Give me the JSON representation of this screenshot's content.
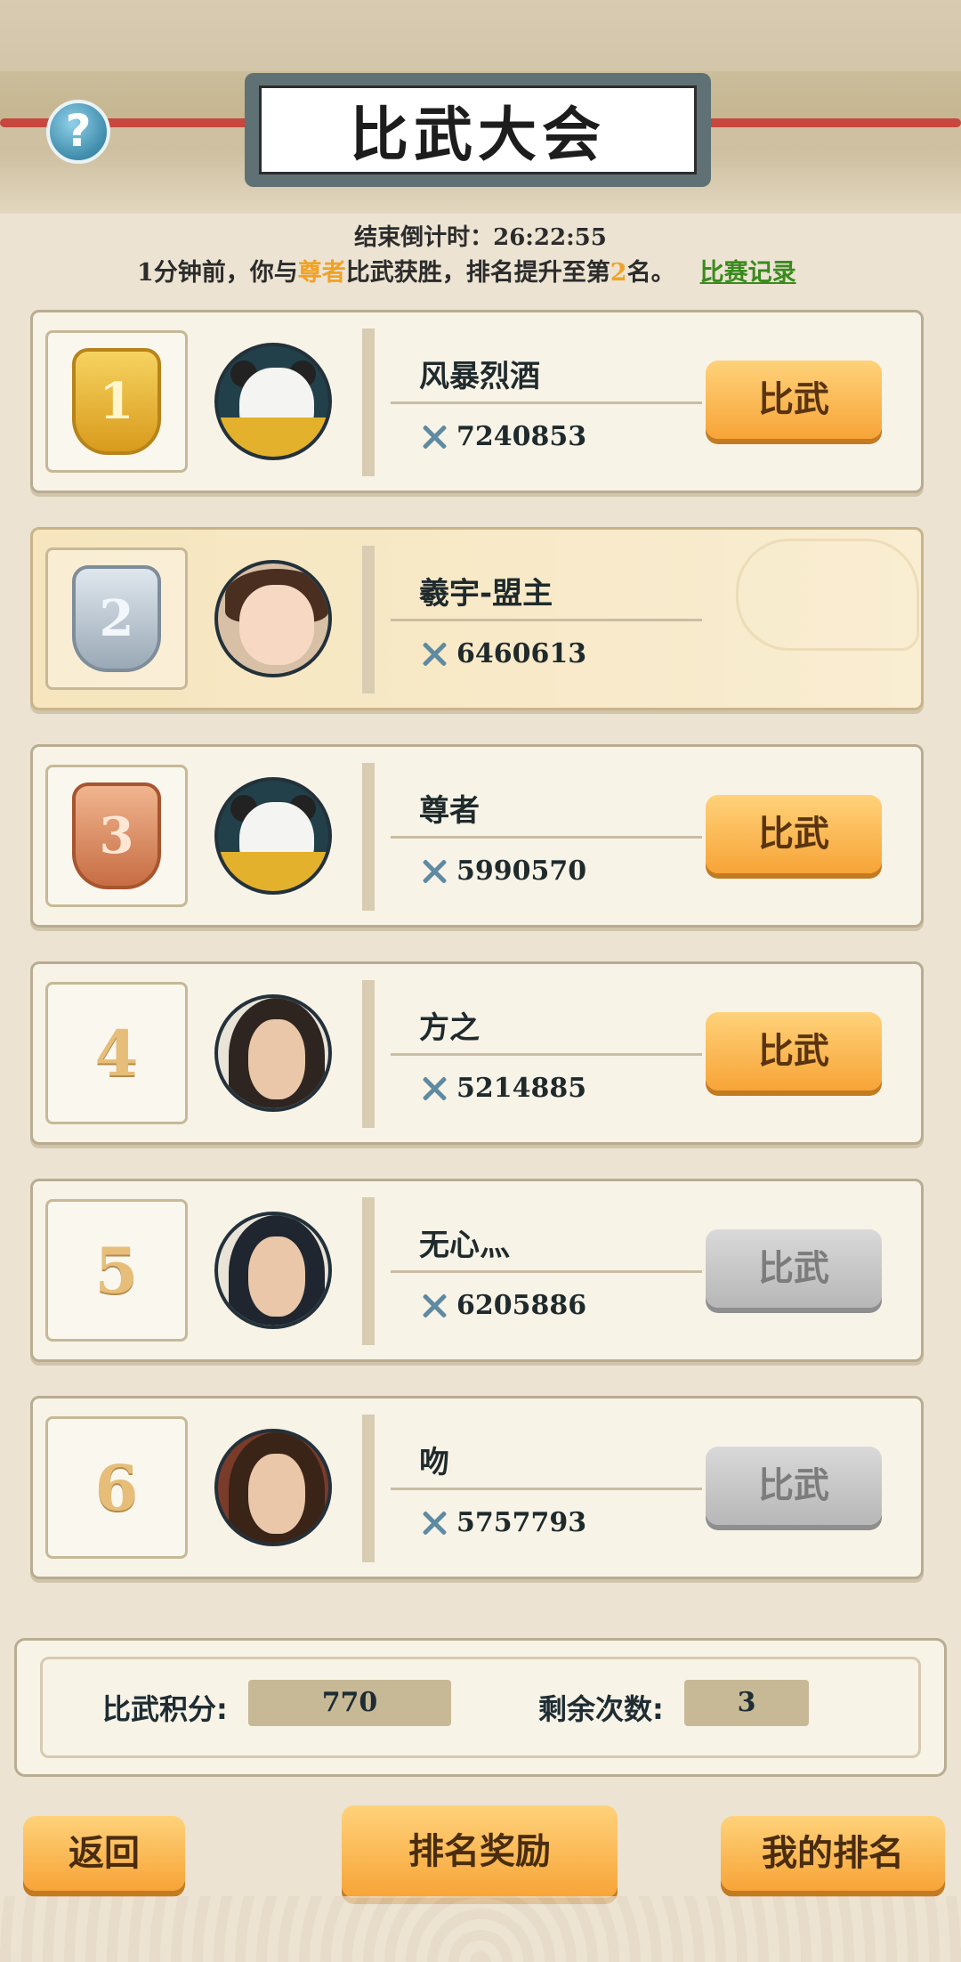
{
  "header": {
    "title": "比武大会",
    "help_icon": "question-mark-icon"
  },
  "status": {
    "countdown": "结束倒计时：26:22:55",
    "notice_prefix": "1分钟前，你与",
    "notice_opponent": "尊者",
    "notice_mid": "比武获胜，排名提升至第",
    "notice_rank": "2",
    "notice_suffix": "名。",
    "record_link": "比赛记录"
  },
  "players": [
    {
      "rank": "1",
      "name": "风暴烈酒",
      "power": "7240853",
      "button": "比武",
      "button_enabled": true,
      "badge": "gold",
      "avatar": "panda"
    },
    {
      "rank": "2",
      "name": "羲宇-盟主",
      "power": "6460613",
      "button": "",
      "button_enabled": false,
      "badge": "silver",
      "avatar": "girl",
      "is_self": true
    },
    {
      "rank": "3",
      "name": "尊者",
      "power": "5990570",
      "button": "比武",
      "button_enabled": true,
      "badge": "bronze",
      "avatar": "panda"
    },
    {
      "rank": "4",
      "name": "方之",
      "power": "5214885",
      "button": "比武",
      "button_enabled": true,
      "badge": "",
      "avatar": "man"
    },
    {
      "rank": "5",
      "name": "无心灬",
      "power": "6205886",
      "button": "比武",
      "button_enabled": false,
      "badge": "",
      "avatar": "man2"
    },
    {
      "rank": "6",
      "name": "吻",
      "power": "5757793",
      "button": "比武",
      "button_enabled": false,
      "badge": "",
      "avatar": "man3"
    }
  ],
  "stats": {
    "score_label": "比武积分:",
    "score_value": "770",
    "remaining_label": "剩余次数:",
    "remaining_value": "3"
  },
  "footer": {
    "back_label": "返回",
    "rank_reward_label": "排名奖励",
    "my_rank_label": "我的排名"
  },
  "colors": {
    "accent_orange": "#f7a437",
    "highlight_text": "#f0a227",
    "link_green": "#3a8a1e"
  }
}
